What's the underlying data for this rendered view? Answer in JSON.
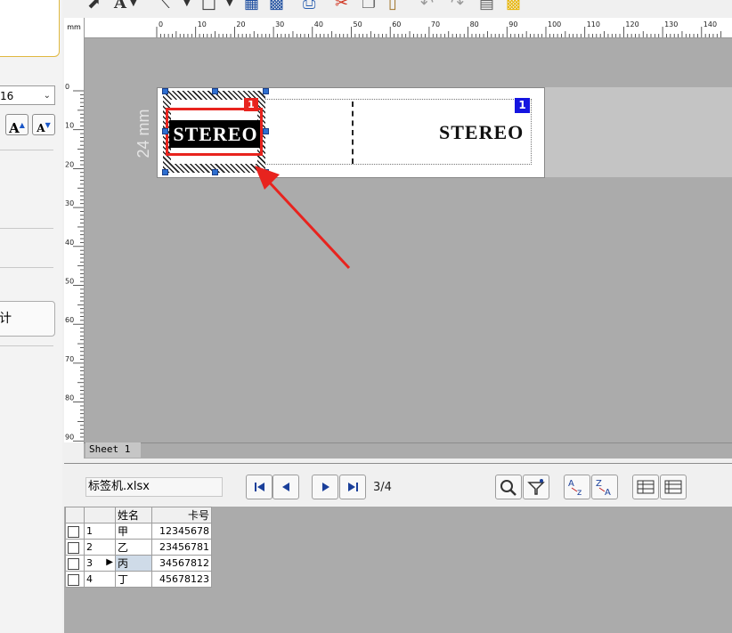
{
  "left_panel": {
    "font_size_value": "16",
    "grow_font_label": "A",
    "shrink_font_label": "A",
    "partial_button_text": "计"
  },
  "toolbar": {
    "icons": [
      "pointer-icon",
      "text-icon",
      "line-icon",
      "rectangle-icon",
      "table-icon",
      "barcode-icon",
      "print-icon",
      "cut-icon",
      "copy-icon",
      "paste-icon",
      "undo-icon",
      "redo-icon",
      "list-icon",
      "database-icon"
    ]
  },
  "ruler": {
    "unit": "mm",
    "top_ticks": [
      "0",
      "10",
      "20",
      "30",
      "40",
      "50",
      "60",
      "70",
      "80",
      "90",
      "100",
      "110",
      "120",
      "130",
      "140"
    ],
    "left_ticks": [
      "0",
      "10",
      "20",
      "30",
      "40",
      "50",
      "60",
      "70",
      "80",
      "90"
    ]
  },
  "label": {
    "left_text": "STEREO",
    "right_text": "STEREO",
    "left_badge": "1",
    "right_badge": "1",
    "height_dimension": "24 mm"
  },
  "sheet_tab": "Sheet 1",
  "data_source": {
    "filename": "标签机.xlsx",
    "pager": "3/4",
    "columns": [
      "姓名",
      "卡号"
    ],
    "rows": [
      {
        "num": "1",
        "name": "甲",
        "card": "12345678"
      },
      {
        "num": "2",
        "name": "乙",
        "card": "23456781"
      },
      {
        "num": "3",
        "name": "丙",
        "card": "34567812"
      },
      {
        "num": "4",
        "name": "丁",
        "card": "45678123"
      }
    ],
    "current_row": 3
  },
  "colors": {
    "workspace": "#ababab",
    "highlight_red": "#e8231e",
    "badge_blue": "#1515e0",
    "handle_blue": "#2e6fd0"
  }
}
